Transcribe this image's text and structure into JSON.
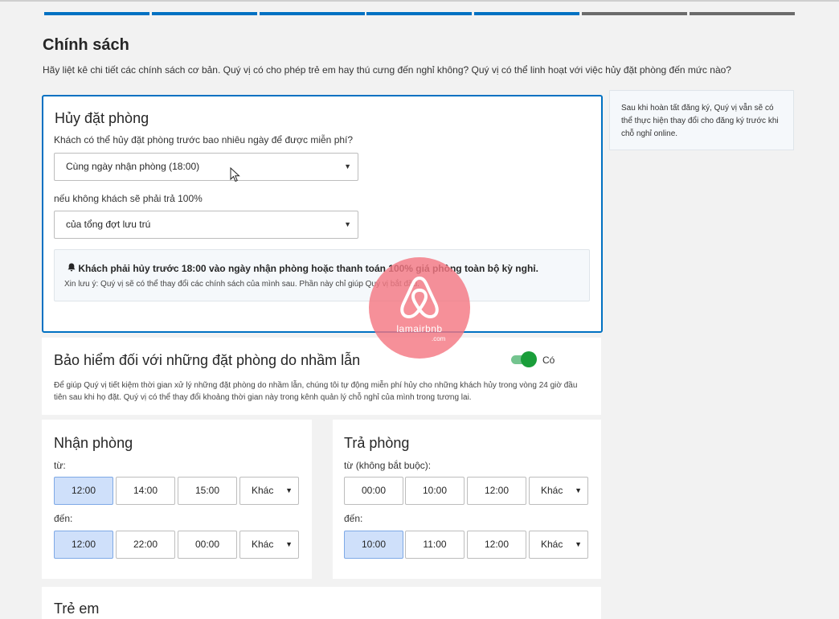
{
  "progress": {
    "completed": 5,
    "total": 7
  },
  "page": {
    "title": "Chính sách",
    "description": "Hãy liệt kê chi tiết các chính sách cơ bản. Quý vị có cho phép trẻ em hay thú cưng đến nghỉ không? Quý vị có thể linh hoạt với việc hủy đặt phòng đến mức nào?"
  },
  "cancellation": {
    "heading": "Hủy đặt phòng",
    "question": "Khách có thể hủy đặt phòng trước bao nhiêu ngày để được miễn phí?",
    "days_select": "Cùng ngày nhận phòng (18:00)",
    "otherwise_label": "nếu không khách sẽ phải trả 100%",
    "charge_select": "của tổng đợt lưu trú",
    "notice_main": "Khách phải hủy trước 18:00 vào ngày nhận phòng hoặc thanh toán 100% giá phòng toàn bộ kỳ nghỉ.",
    "notice_sub": "Xin lưu ý: Quý vị sẽ có thể thay đổi các chính sách của mình sau. Phần này chỉ giúp Quý vị bắt đầu."
  },
  "sidebar_tip": "Sau khi hoàn tất đăng ký, Quý vị vẫn sẽ có thể thực hiện thay đổi cho đăng ký trước khi chỗ nghỉ online.",
  "insurance": {
    "heading": "Bảo hiểm đối với những đặt phòng do nhầm lẫn",
    "toggle_label": "Có",
    "toggle_on": true,
    "description": "Để giúp Quý vị tiết kiệm thời gian xử lý những đặt phòng do nhầm lẫn, chúng tôi tự động miễn phí hủy cho những khách hủy trong vòng 24 giờ đầu tiên sau khi họ đặt. Quý vị có thể thay đổi khoảng thời gian này trong kênh quản lý chỗ nghỉ của mình trong tương lai."
  },
  "checkin": {
    "heading": "Nhận phòng",
    "from_label": "từ:",
    "from_times": [
      "12:00",
      "14:00",
      "15:00"
    ],
    "from_other": "Khác",
    "to_label": "đến:",
    "to_times": [
      "12:00",
      "22:00",
      "00:00"
    ],
    "to_other": "Khác"
  },
  "checkout": {
    "heading": "Trả phòng",
    "from_label": "từ (không bắt buộc):",
    "from_times": [
      "00:00",
      "10:00",
      "12:00"
    ],
    "from_other": "Khác",
    "to_label": "đến:",
    "to_times": [
      "10:00",
      "11:00",
      "12:00"
    ],
    "to_other": "Khác"
  },
  "children": {
    "heading": "Trẻ em"
  },
  "watermark": {
    "text": "lamairbnb",
    "suffix": ".com"
  },
  "colors": {
    "accent": "#0071c2",
    "selected_bg": "#cfe0fa",
    "toggle_on": "#1a9e3a"
  }
}
